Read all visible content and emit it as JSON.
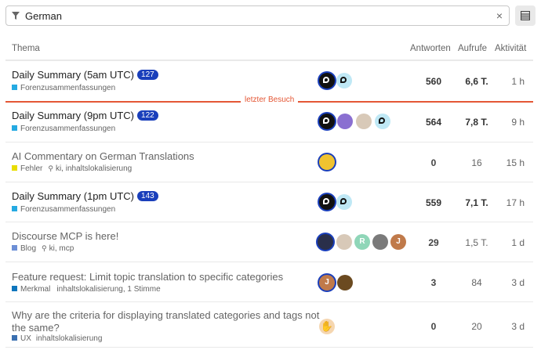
{
  "filter": {
    "value": "German",
    "clear_icon": "×",
    "icons": [
      "filter-icon",
      "clear-icon",
      "list-view-icon"
    ]
  },
  "table": {
    "headers": {
      "topic": "Thema",
      "replies": "Antworten",
      "views": "Aufrufe",
      "activity": "Aktivität"
    },
    "last_visit_label": "letzter Besuch",
    "rows": [
      {
        "title": "Daily Summary (5am UTC)",
        "badge": "127",
        "category": "Forenzusammenfassungen",
        "category_color": "#25aae2",
        "tags": "",
        "replies": "560",
        "views": "6,6 T.",
        "activity": "1 h",
        "unread": true
      },
      {
        "title": "Daily Summary (9pm UTC)",
        "badge": "122",
        "category": "Forenzusammenfassungen",
        "category_color": "#25aae2",
        "tags": "",
        "replies": "564",
        "views": "7,8 T.",
        "activity": "9 h",
        "unread": true
      },
      {
        "title": "AI Commentary on German Translations",
        "badge": "",
        "category": "Fehler",
        "category_color": "#e9dd00",
        "tags": "ki, inhaltslokalisierung",
        "replies": "0",
        "views": "16",
        "activity": "15 h",
        "unread": false
      },
      {
        "title": "Daily Summary (1pm UTC)",
        "badge": "143",
        "category": "Forenzusammenfassungen",
        "category_color": "#25aae2",
        "tags": "",
        "replies": "559",
        "views": "7,1 T.",
        "activity": "17 h",
        "unread": true
      },
      {
        "title": "Discourse MCP is here!",
        "badge": "",
        "category": "Blog",
        "category_color": "#6d8fd6",
        "tags": "ki, mcp",
        "replies": "29",
        "views": "1,5 T.",
        "activity": "1 d",
        "unread": false
      },
      {
        "title": "Feature request: Limit topic translation to specific categories",
        "badge": "",
        "category": "Merkmal",
        "category_color": "#0e76bd",
        "tags": "inhaltslokalisierung, 1 Stimme",
        "replies": "3",
        "views": "84",
        "activity": "3 d",
        "unread": false
      },
      {
        "title_line1": "Why are the criteria for displaying translated categories and tags not",
        "title_line2": "the same?",
        "badge": "",
        "category": "UX",
        "category_color": "#3a6fb0",
        "tags": "inhaltslokalisierung",
        "replies": "0",
        "views": "20",
        "activity": "3 d",
        "unread": false
      }
    ],
    "avatars": {
      "row0": [
        "discourse-logo-avatar",
        "discourse-light-avatar"
      ],
      "row1": [
        "discourse-logo-avatar",
        "user-avatar-purple",
        "user-avatar-face",
        "discourse-light-avatar"
      ],
      "row2": [
        "user-avatar-yellow"
      ],
      "row3": [
        "discourse-logo-avatar",
        "discourse-light-avatar"
      ],
      "row4": [
        {
          "name": "user-avatar-dark",
          "letter": ""
        },
        {
          "name": "user-avatar-face",
          "letter": ""
        },
        {
          "name": "user-avatar-r",
          "letter": "R"
        },
        {
          "name": "user-avatar-gray",
          "letter": ""
        },
        {
          "name": "user-avatar-j",
          "letter": "J"
        }
      ],
      "row5": [
        {
          "name": "user-avatar-j",
          "letter": "J"
        },
        {
          "name": "user-avatar-brown",
          "letter": ""
        }
      ],
      "row6": [
        "hand-emoji-avatar"
      ]
    }
  }
}
